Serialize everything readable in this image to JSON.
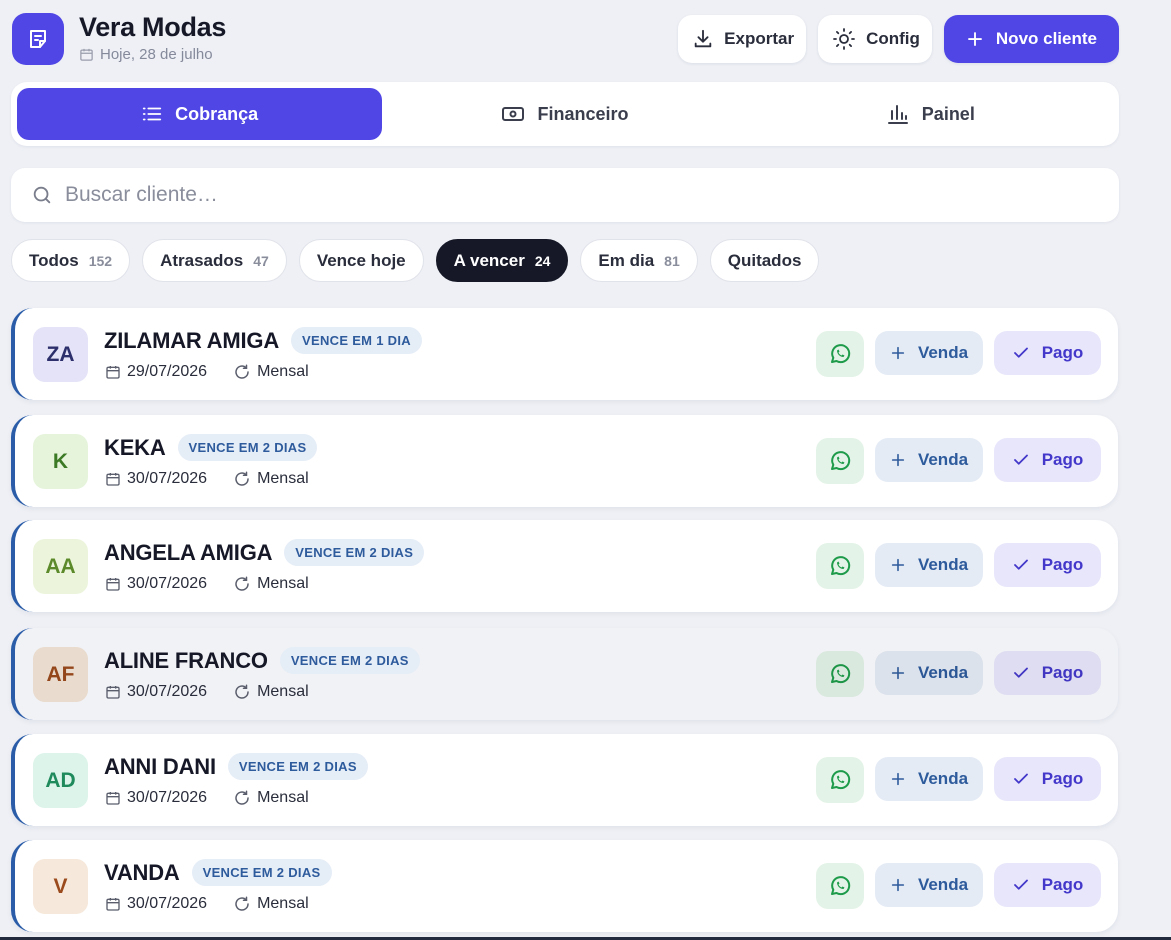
{
  "app": {
    "title": "Vera Modas",
    "date": "Hoje, 28 de julho",
    "export_label": "Exportar",
    "config_label": "Config",
    "new_client_label": "Novo cliente",
    "accent": "#5046e5"
  },
  "tabs": [
    {
      "label": "Cobrança",
      "icon": "list-icon",
      "active": true
    },
    {
      "label": "Financeiro",
      "icon": "banknote-icon",
      "active": false
    },
    {
      "label": "Painel",
      "icon": "bar-chart-icon",
      "active": false
    }
  ],
  "search": {
    "placeholder": "Buscar cliente…",
    "value": ""
  },
  "filters": [
    {
      "label": "Todos",
      "count": "152",
      "active": false
    },
    {
      "label": "Atrasados",
      "count": "47",
      "active": false
    },
    {
      "label": "Vence hoje",
      "count": "",
      "active": false
    },
    {
      "label": "A vencer",
      "count": "24",
      "active": true
    },
    {
      "label": "Em dia",
      "count": "81",
      "active": false
    },
    {
      "label": "Quitados",
      "count": "",
      "active": false
    }
  ],
  "clients": [
    {
      "initials": "ZA",
      "name": "ZILAMAR AMIGA",
      "badge": "VENCE EM 1 DIA",
      "date": "29/07/2026",
      "recurrence": "Mensal",
      "avatar_bg": "#e4e3f7",
      "avatar_fg": "#2c2f6b"
    },
    {
      "initials": "K",
      "name": "KEKA",
      "badge": "VENCE EM 2 DIAS",
      "date": "30/07/2026",
      "recurrence": "Mensal",
      "avatar_bg": "#e6f4dc",
      "avatar_fg": "#3d7a25"
    },
    {
      "initials": "AA",
      "name": "ANGELA AMIGA",
      "badge": "VENCE EM 2 DIAS",
      "date": "30/07/2026",
      "recurrence": "Mensal",
      "avatar_bg": "#ecf5dc",
      "avatar_fg": "#5c8a2a"
    },
    {
      "initials": "AF",
      "name": "ALINE FRANCO",
      "badge": "VENCE EM 2 DIAS",
      "date": "30/07/2026",
      "recurrence": "Mensal",
      "avatar_bg": "#f3e4d6",
      "avatar_fg": "#9a4a1c"
    },
    {
      "initials": "AD",
      "name": "ANNI DANI",
      "badge": "VENCE EM 2 DIAS",
      "date": "30/07/2026",
      "recurrence": "Mensal",
      "avatar_bg": "#dcf4ea",
      "avatar_fg": "#1f8a5c"
    },
    {
      "initials": "V",
      "name": "VANDA",
      "badge": "VENCE EM 2 DIAS",
      "date": "30/07/2026",
      "recurrence": "Mensal",
      "avatar_bg": "#f6e8da",
      "avatar_fg": "#9a4a1c"
    }
  ],
  "actions": {
    "venda_label": "Venda",
    "pago_label": "Pago"
  }
}
